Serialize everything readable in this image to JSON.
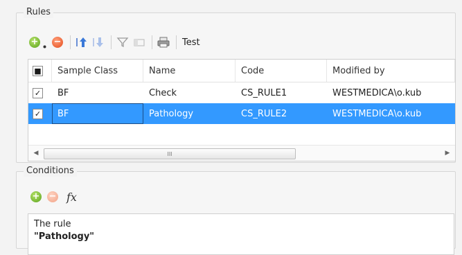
{
  "rules_group": {
    "title": "Rules",
    "toolbar": {
      "add_icon": "plus-circle-green",
      "remove_icon": "minus-circle-red",
      "move_up_icon": "arrow-up",
      "move_down_icon": "arrow-down",
      "filter_icon": "funnel",
      "disabled_icon": "card",
      "print_icon": "printer",
      "test_label": "Test"
    },
    "table": {
      "columns": [
        "Sample Class",
        "Name",
        "Code",
        "Modified by"
      ],
      "rows": [
        {
          "checked": true,
          "sample_class": "BF",
          "name": "Check",
          "code": "CS_RULE1",
          "modified_by": "WESTMEDICA\\o.kub",
          "selected": false
        },
        {
          "checked": true,
          "sample_class": "BF",
          "name": "Pathology",
          "code": "CS_RULE2",
          "modified_by": "WESTMEDICA\\o.kub",
          "selected": true
        }
      ],
      "scroll_thumb_glyph": "III",
      "scroll_left": "◀",
      "scroll_right": "▶"
    }
  },
  "conditions_group": {
    "title": "Conditions",
    "toolbar": {
      "fx_label": "fx"
    },
    "text_line1": "The rule",
    "text_line2": "\"Pathology\""
  },
  "colors": {
    "selection": "#3399ff",
    "add_green": "#59a21c",
    "remove_red": "#e44c1d"
  }
}
